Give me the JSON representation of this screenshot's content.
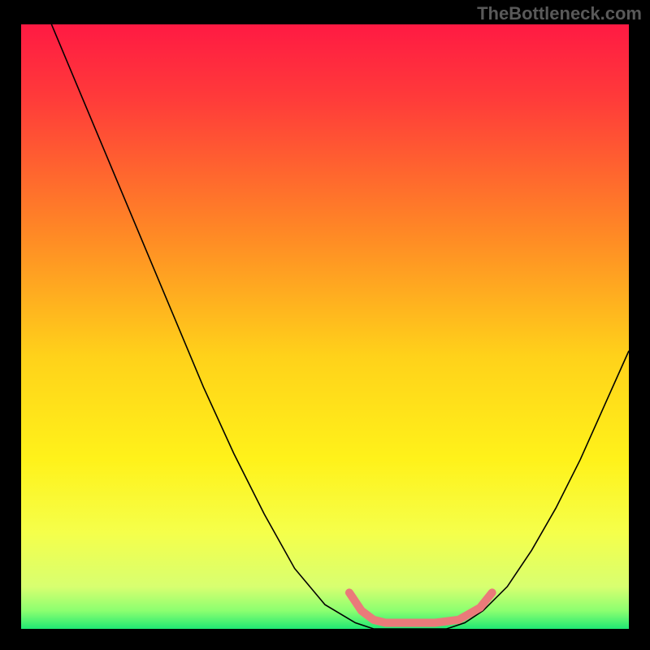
{
  "watermark": "TheBottleneck.com",
  "chart_data": {
    "type": "line",
    "title": "",
    "xlabel": "",
    "ylabel": "",
    "xlim": [
      0,
      100
    ],
    "ylim": [
      0,
      100
    ],
    "background_gradient_stops": [
      {
        "pct": 0,
        "color": "#ff1a43"
      },
      {
        "pct": 12,
        "color": "#ff3a3a"
      },
      {
        "pct": 35,
        "color": "#ff8a25"
      },
      {
        "pct": 55,
        "color": "#ffd21a"
      },
      {
        "pct": 72,
        "color": "#fff21a"
      },
      {
        "pct": 84,
        "color": "#f5ff4a"
      },
      {
        "pct": 93,
        "color": "#d8ff70"
      },
      {
        "pct": 97,
        "color": "#8cff70"
      },
      {
        "pct": 100,
        "color": "#20e873"
      }
    ],
    "series": [
      {
        "name": "curve",
        "color": "#000000",
        "width": 1.6,
        "points": [
          {
            "x": 5,
            "y": 100
          },
          {
            "x": 10,
            "y": 88
          },
          {
            "x": 15,
            "y": 76
          },
          {
            "x": 20,
            "y": 64
          },
          {
            "x": 25,
            "y": 52
          },
          {
            "x": 30,
            "y": 40
          },
          {
            "x": 35,
            "y": 29
          },
          {
            "x": 40,
            "y": 19
          },
          {
            "x": 45,
            "y": 10
          },
          {
            "x": 50,
            "y": 4
          },
          {
            "x": 55,
            "y": 1
          },
          {
            "x": 58,
            "y": 0
          },
          {
            "x": 62,
            "y": 0
          },
          {
            "x": 66,
            "y": 0
          },
          {
            "x": 70,
            "y": 0
          },
          {
            "x": 73,
            "y": 1
          },
          {
            "x": 76,
            "y": 3
          },
          {
            "x": 80,
            "y": 7
          },
          {
            "x": 84,
            "y": 13
          },
          {
            "x": 88,
            "y": 20
          },
          {
            "x": 92,
            "y": 28
          },
          {
            "x": 96,
            "y": 37
          },
          {
            "x": 100,
            "y": 46
          }
        ]
      },
      {
        "name": "bottom-marker",
        "color": "#ea7a7a",
        "width": 10,
        "linecap": "round",
        "points": [
          {
            "x": 54,
            "y": 6
          },
          {
            "x": 56,
            "y": 3
          },
          {
            "x": 58,
            "y": 1.5
          },
          {
            "x": 60,
            "y": 1
          },
          {
            "x": 64,
            "y": 1
          },
          {
            "x": 68,
            "y": 1
          },
          {
            "x": 72,
            "y": 1.5
          },
          {
            "x": 75.5,
            "y": 3.5
          },
          {
            "x": 77.5,
            "y": 6
          }
        ]
      }
    ]
  }
}
